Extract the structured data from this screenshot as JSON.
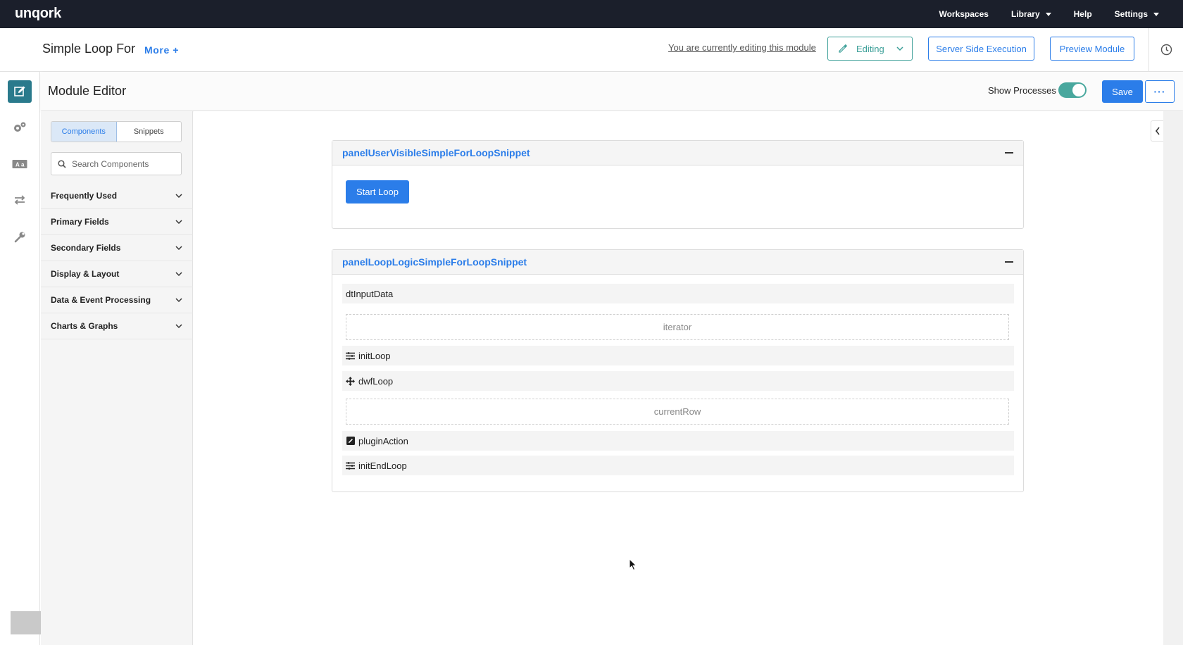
{
  "nav": {
    "logo": "unqork",
    "links": [
      {
        "label": "Workspaces",
        "caret": false
      },
      {
        "label": "Library",
        "caret": true
      },
      {
        "label": "Help",
        "caret": false
      },
      {
        "label": "Settings",
        "caret": true
      }
    ]
  },
  "module": {
    "title": "Simple Loop For",
    "more_label": "More +",
    "editing_note": "You are currently editing this module",
    "editing_label": "Editing",
    "sse_label": "Server Side Execution",
    "preview_label": "Preview Module"
  },
  "rail": {
    "icons": [
      "edit-icon",
      "gears-icon",
      "translate-icon",
      "transfer-icon",
      "wrench-icon"
    ]
  },
  "editor": {
    "title": "Module Editor",
    "show_processes_label": "Show Processes",
    "show_processes_on": true,
    "save_label": "Save",
    "more_label": "···"
  },
  "sidebar": {
    "tabs": [
      {
        "label": "Components",
        "active": true
      },
      {
        "label": "Snippets",
        "active": false
      }
    ],
    "search_placeholder": "Search Components",
    "categories": [
      "Frequently Used",
      "Primary Fields",
      "Secondary Fields",
      "Display & Layout",
      "Data & Event Processing",
      "Charts & Graphs"
    ]
  },
  "canvas": {
    "panel1": {
      "title": "panelUserVisibleSimpleForLoopSnippet",
      "button_label": "Start Loop"
    },
    "panel2": {
      "title": "panelLoopLogicSimpleForLoopSnippet",
      "items": [
        {
          "type": "row",
          "icon": "",
          "label": "dtInputData"
        },
        {
          "type": "dropzone",
          "label": "iterator"
        },
        {
          "type": "row",
          "icon": "list-icon",
          "label": "initLoop"
        },
        {
          "type": "row",
          "icon": "move-icon",
          "label": "dwfLoop"
        },
        {
          "type": "dropzone",
          "label": "currentRow"
        },
        {
          "type": "row",
          "icon": "plugin-icon",
          "label": "pluginAction"
        },
        {
          "type": "row",
          "icon": "list-icon",
          "label": "initEndLoop"
        }
      ]
    }
  },
  "colors": {
    "nav_bg": "#1b1f2b",
    "accent": "#2b7de9",
    "teal": "#3a9e97",
    "rail_active": "#2a7a8c"
  }
}
